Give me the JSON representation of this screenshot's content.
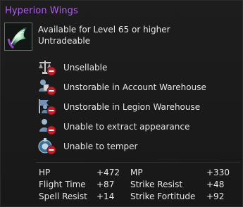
{
  "title": "Hyperion Wings",
  "info": {
    "level_req": "Available for Level 65 or higher",
    "trade": "Untradeable"
  },
  "restrictions": [
    {
      "label": "Unsellable",
      "icon": "scale-no-icon"
    },
    {
      "label": "Unstorable in Account Warehouse",
      "icon": "account-warehouse-no-icon"
    },
    {
      "label": "Unstorable in Legion Warehouse",
      "icon": "legion-warehouse-no-icon"
    },
    {
      "label": "Unable to extract appearance",
      "icon": "extract-appearance-no-icon"
    },
    {
      "label": "Unable to temper",
      "icon": "temper-no-icon"
    }
  ],
  "stats": [
    {
      "name": "HP",
      "value": "+472"
    },
    {
      "name": "MP",
      "value": "+330"
    },
    {
      "name": "Flight Time",
      "value": "+87"
    },
    {
      "name": "Strike Resist",
      "value": "+48"
    },
    {
      "name": "Spell Resist",
      "value": "+14"
    },
    {
      "name": "Strike Fortitude",
      "value": "+92"
    }
  ],
  "colors": {
    "title": "#b35cf0",
    "text": "#e6e6e6",
    "no_badge": "#c0222a"
  }
}
